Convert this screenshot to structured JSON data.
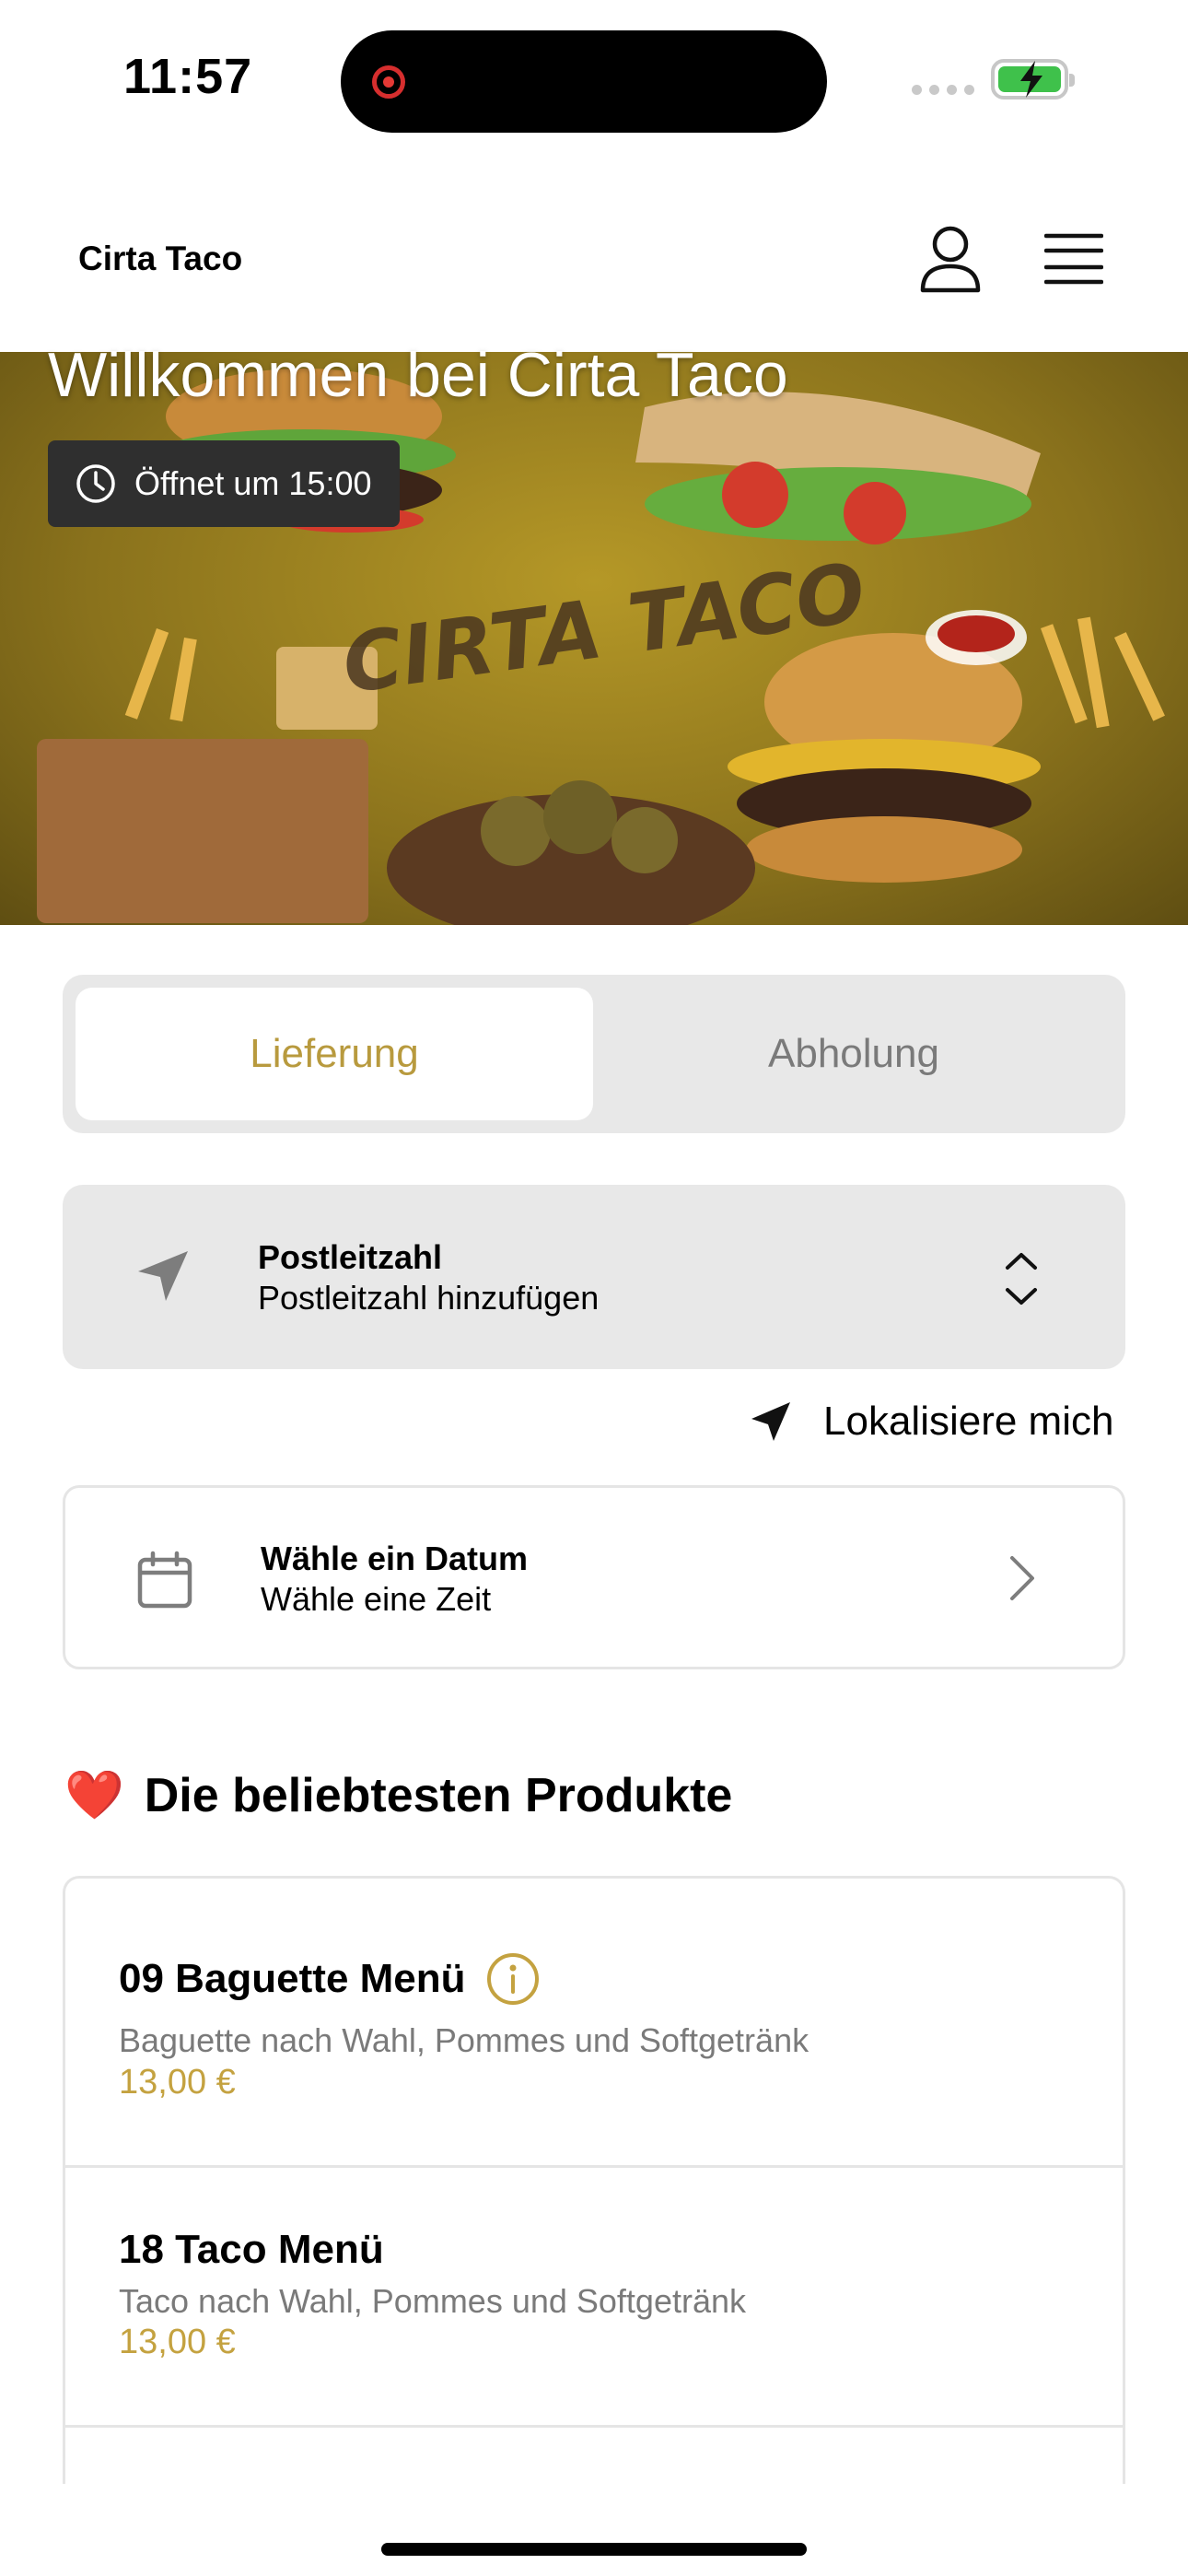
{
  "status_bar": {
    "time": "11:57"
  },
  "header": {
    "brand": "Cirta Taco"
  },
  "hero": {
    "title": "Willkommen bei Cirta Taco",
    "badge": "Öffnet um 15:00",
    "logo_text": "CIRTA TACO"
  },
  "mode_toggle": {
    "options": [
      {
        "label": "Lieferung",
        "active": true
      },
      {
        "label": "Abholung",
        "active": false
      }
    ]
  },
  "postcode": {
    "title": "Postleitzahl",
    "subtitle": "Postleitzahl hinzufügen"
  },
  "locate": {
    "label": "Lokalisiere mich"
  },
  "date_picker": {
    "title": "Wähle ein Datum",
    "subtitle": "Wähle eine Zeit"
  },
  "popular": {
    "emoji": "❤️",
    "title": "Die beliebtesten Produkte",
    "items": [
      {
        "name": "09 Baguette Menü",
        "description": "Baguette nach Wahl, Pommes und Softgetränk",
        "price": "13,00 €",
        "has_info": true
      },
      {
        "name": "18 Taco Menü",
        "description": "Taco nach Wahl, Pommes und Softgetränk",
        "price": "13,00 €",
        "has_info": false
      }
    ]
  },
  "colors": {
    "accent": "#b89a3e",
    "price": "#c4a240",
    "hero_bg": "#8a721c",
    "panel_bg": "#e8e8e8",
    "battery": "#3fc14b"
  },
  "icons": [
    "record-icon",
    "signal-icon",
    "battery-charging-icon",
    "user-icon",
    "menu-icon",
    "clock-icon",
    "location-arrow-icon",
    "chevron-up-down-icon",
    "calendar-icon",
    "chevron-right-icon",
    "heart-icon",
    "info-icon"
  ]
}
